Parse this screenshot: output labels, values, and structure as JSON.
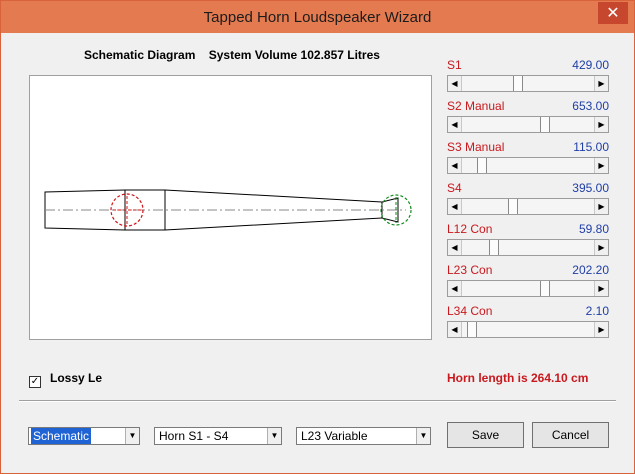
{
  "window": {
    "title": "Tapped Horn Loudspeaker Wizard",
    "close_glyph": "✕"
  },
  "schematic": {
    "label": "Schematic Diagram",
    "volume": "System Volume 102.857 Litres"
  },
  "sliders": [
    {
      "label": "S1",
      "value": "429.00",
      "position": 0.42
    },
    {
      "label": "S2  Manual",
      "value": "653.00",
      "position": 0.64
    },
    {
      "label": "S3  Manual",
      "value": "115.00",
      "position": 0.12
    },
    {
      "label": "S4",
      "value": "395.00",
      "position": 0.38
    },
    {
      "label": "L12  Con",
      "value": "59.80",
      "position": 0.22
    },
    {
      "label": "L23  Con",
      "value": "202.20",
      "position": 0.64
    },
    {
      "label": "L34  Con",
      "value": "2.10",
      "position": 0.04
    }
  ],
  "lossy": {
    "label": "Lossy Le",
    "checked": true,
    "check_glyph": "✓"
  },
  "horn_length": "Horn length is 264.10 cm",
  "combos": {
    "view": "Schematic",
    "horn": "Horn S1 - S4",
    "variable": "L23 Variable"
  },
  "buttons": {
    "save": "Save",
    "cancel": "Cancel"
  },
  "icons": {
    "scroll_left": "◀",
    "scroll_right": "▶",
    "dropdown": "▼"
  },
  "colors": {
    "titlebar": "#e47a4f",
    "label_red": "#c8191e",
    "value_blue": "#1f3ea6",
    "driver_red": "#d0141a",
    "port_green": "#138a1f"
  }
}
